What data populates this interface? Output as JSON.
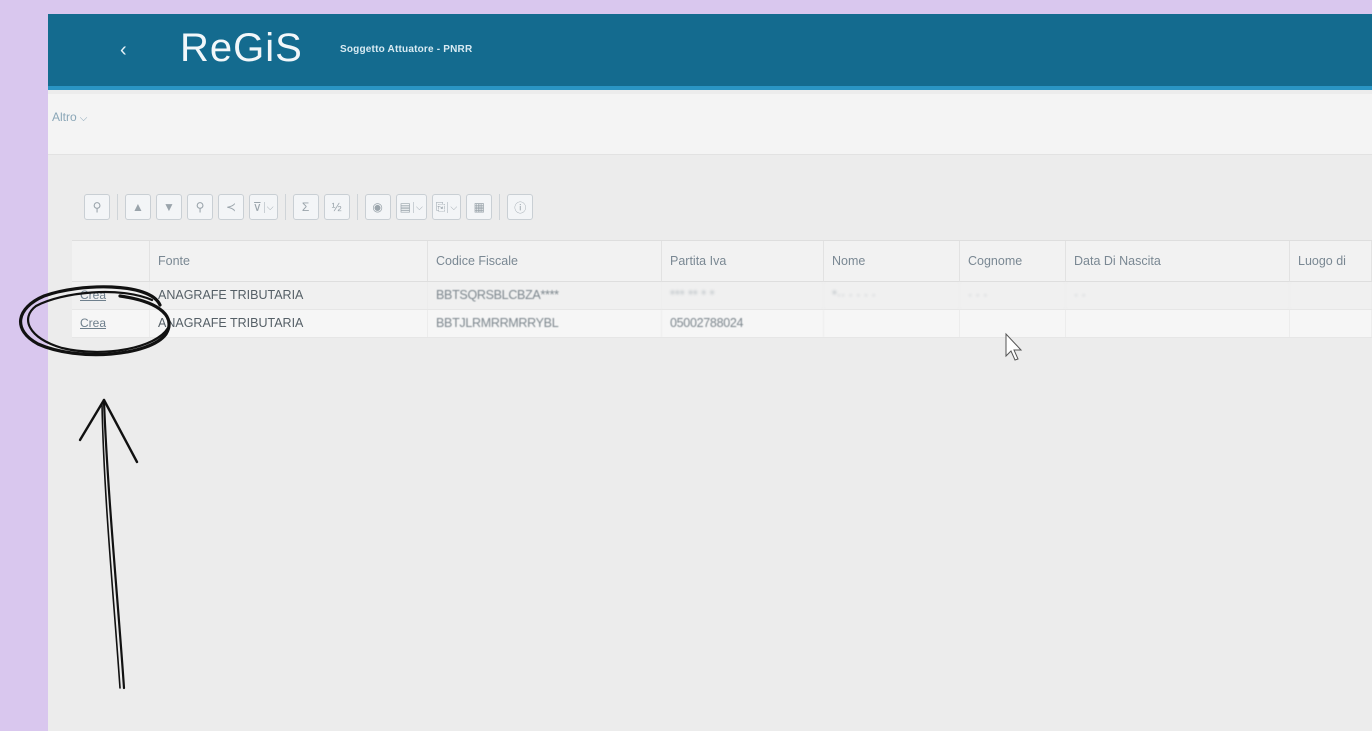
{
  "header": {
    "back_symbol": "‹",
    "logo": "ReGiS",
    "subtitle": "Soggetto Attuatore - PNRR"
  },
  "subbar": {
    "menu_label": "Altro",
    "menu_chevron": "⌵"
  },
  "toolbar": {
    "buttons": [
      {
        "name": "zoom-icon",
        "glyph": "⚲"
      },
      {
        "name": "sort-ascending-icon",
        "glyph": "▲"
      },
      {
        "name": "sort-descending-icon",
        "glyph": "▼"
      },
      {
        "name": "search-icon",
        "glyph": "⚲"
      },
      {
        "name": "share-icon",
        "glyph": "≺"
      },
      {
        "name": "filter-icon",
        "glyph": "⊽"
      },
      {
        "name": "sum-icon",
        "glyph": "Σ"
      },
      {
        "name": "subtotal-icon",
        "glyph": "½"
      },
      {
        "name": "globe-icon",
        "glyph": "◉"
      },
      {
        "name": "layout-icon",
        "glyph": "▤"
      },
      {
        "name": "export-icon",
        "glyph": "⎘"
      },
      {
        "name": "print-icon",
        "glyph": "▦"
      },
      {
        "name": "info-icon",
        "glyph": "ⓘ"
      }
    ],
    "dropdown_symbol": "⌵"
  },
  "table": {
    "columns": [
      "",
      "Fonte",
      "Codice Fiscale",
      "Partita Iva",
      "Nome",
      "Cognome",
      "Data Di Nascita",
      "Luogo di"
    ],
    "rows": [
      {
        "action": "Crea",
        "fonte": "ANAGRAFE TRIBUTARIA",
        "codice_fiscale": "BBTSQRSBLCBZA****",
        "partita_iva": "***  ** * *",
        "nome": "*·· · · · ·",
        "cognome": "· · ·",
        "data_nascita": "· ·",
        "luogo": ""
      },
      {
        "action": "Crea",
        "fonte": "ANAGRAFE TRIBUTARIA",
        "codice_fiscale": "BBTJLRMRRMRRYBL",
        "partita_iva": "05002788024",
        "nome": "",
        "cognome": "",
        "data_nascita": "",
        "luogo": ""
      }
    ]
  },
  "colors": {
    "header_bg": "#146b8f",
    "header_accent": "#2a95c4",
    "page_bg": "#d9c7ee",
    "annotation_ink": "#111111"
  }
}
